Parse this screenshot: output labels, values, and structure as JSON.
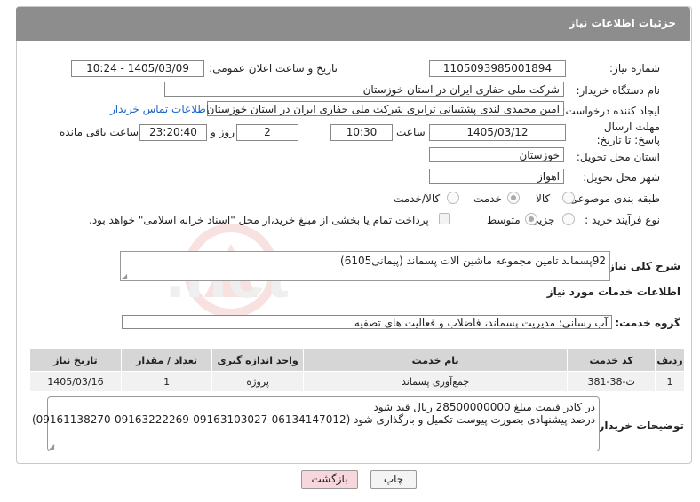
{
  "header": {
    "title": "جزئیات اطلاعات نیاز"
  },
  "form": {
    "need_number_label": "شماره نیاز:",
    "need_number": "1105093985001894",
    "announce_label": "تاریخ و ساعت اعلان عمومی:",
    "announce_value": "1405/03/09 - 10:24",
    "buyer_org_label": "نام دستگاه خریدار:",
    "buyer_org": "شرکت ملی حفاری ایران در استان خوزستان",
    "requester_label": "ایجاد کننده درخواست:",
    "requester": "امین محمدی لندی پشتیبانی ترابری شرکت ملی حفاری ایران در استان خوزستان",
    "contact_link": "اطلاعات تماس خریدار",
    "deadline_label": "مهلت ارسال پاسخ: تا تاریخ:",
    "deadline_date": "1405/03/12",
    "time_label": "ساعت",
    "deadline_time": "10:30",
    "days_value": "2",
    "days_label": "روز و",
    "remaining_time": "23:20:40",
    "remaining_label": "ساعت باقی مانده",
    "province_label": "استان محل تحویل:",
    "province": "خوزستان",
    "city_label": "شهر محل تحویل:",
    "city": "اهواز",
    "category_label": "طبقه بندی موضوعی:",
    "category_options": [
      "کالا",
      "خدمت",
      "کالا/خدمت"
    ],
    "category_selected": "خدمت",
    "process_label": "نوع فرآیند خرید :",
    "process_options": [
      "جزیی",
      "متوسط"
    ],
    "process_selected": "متوسط",
    "payment_note": "پرداخت تمام یا بخشی از مبلغ خرید،از محل \"اسناد خزانه اسلامی\" خواهد بود."
  },
  "description": {
    "label": "شرح کلی نیاز:",
    "text": "92پسماند تامین مجموعه ماشین آلات پسماند (پیمانی6105)"
  },
  "services": {
    "section_title": "اطلاعات خدمات مورد نیاز",
    "group_label": "گروه خدمت:",
    "group_value": "آب رسانی؛ مدیریت پسماند، فاضلاب و فعالیت های تصفیه",
    "columns": [
      "ردیف",
      "کد خدمت",
      "نام خدمت",
      "واحد اندازه گیری",
      "تعداد / مقدار",
      "تاریخ نیاز"
    ],
    "rows": [
      [
        "1",
        "ث-38-381",
        "جمع‌آوری پسماند",
        "پروژه",
        "1",
        "1405/03/16"
      ]
    ]
  },
  "buyer_notes": {
    "label": "توضیحات خریدار:",
    "line1": "در کادر قیمت مبلغ 28500000000 ریال قید شود",
    "line2": "درصد پیشنهادی بصورت پیوست تکمیل و بارگذاری شود (06134147012-09163103027-09163222269-09161138270)"
  },
  "buttons": {
    "print": "چاپ",
    "back": "بازگشت"
  },
  "watermark": "AriaTender.net",
  "colors": {
    "header_bg": "#8d8d8d",
    "link": "#1a64c8",
    "back_btn": "#f7d7dc",
    "table_head": "#d6d6d6"
  }
}
